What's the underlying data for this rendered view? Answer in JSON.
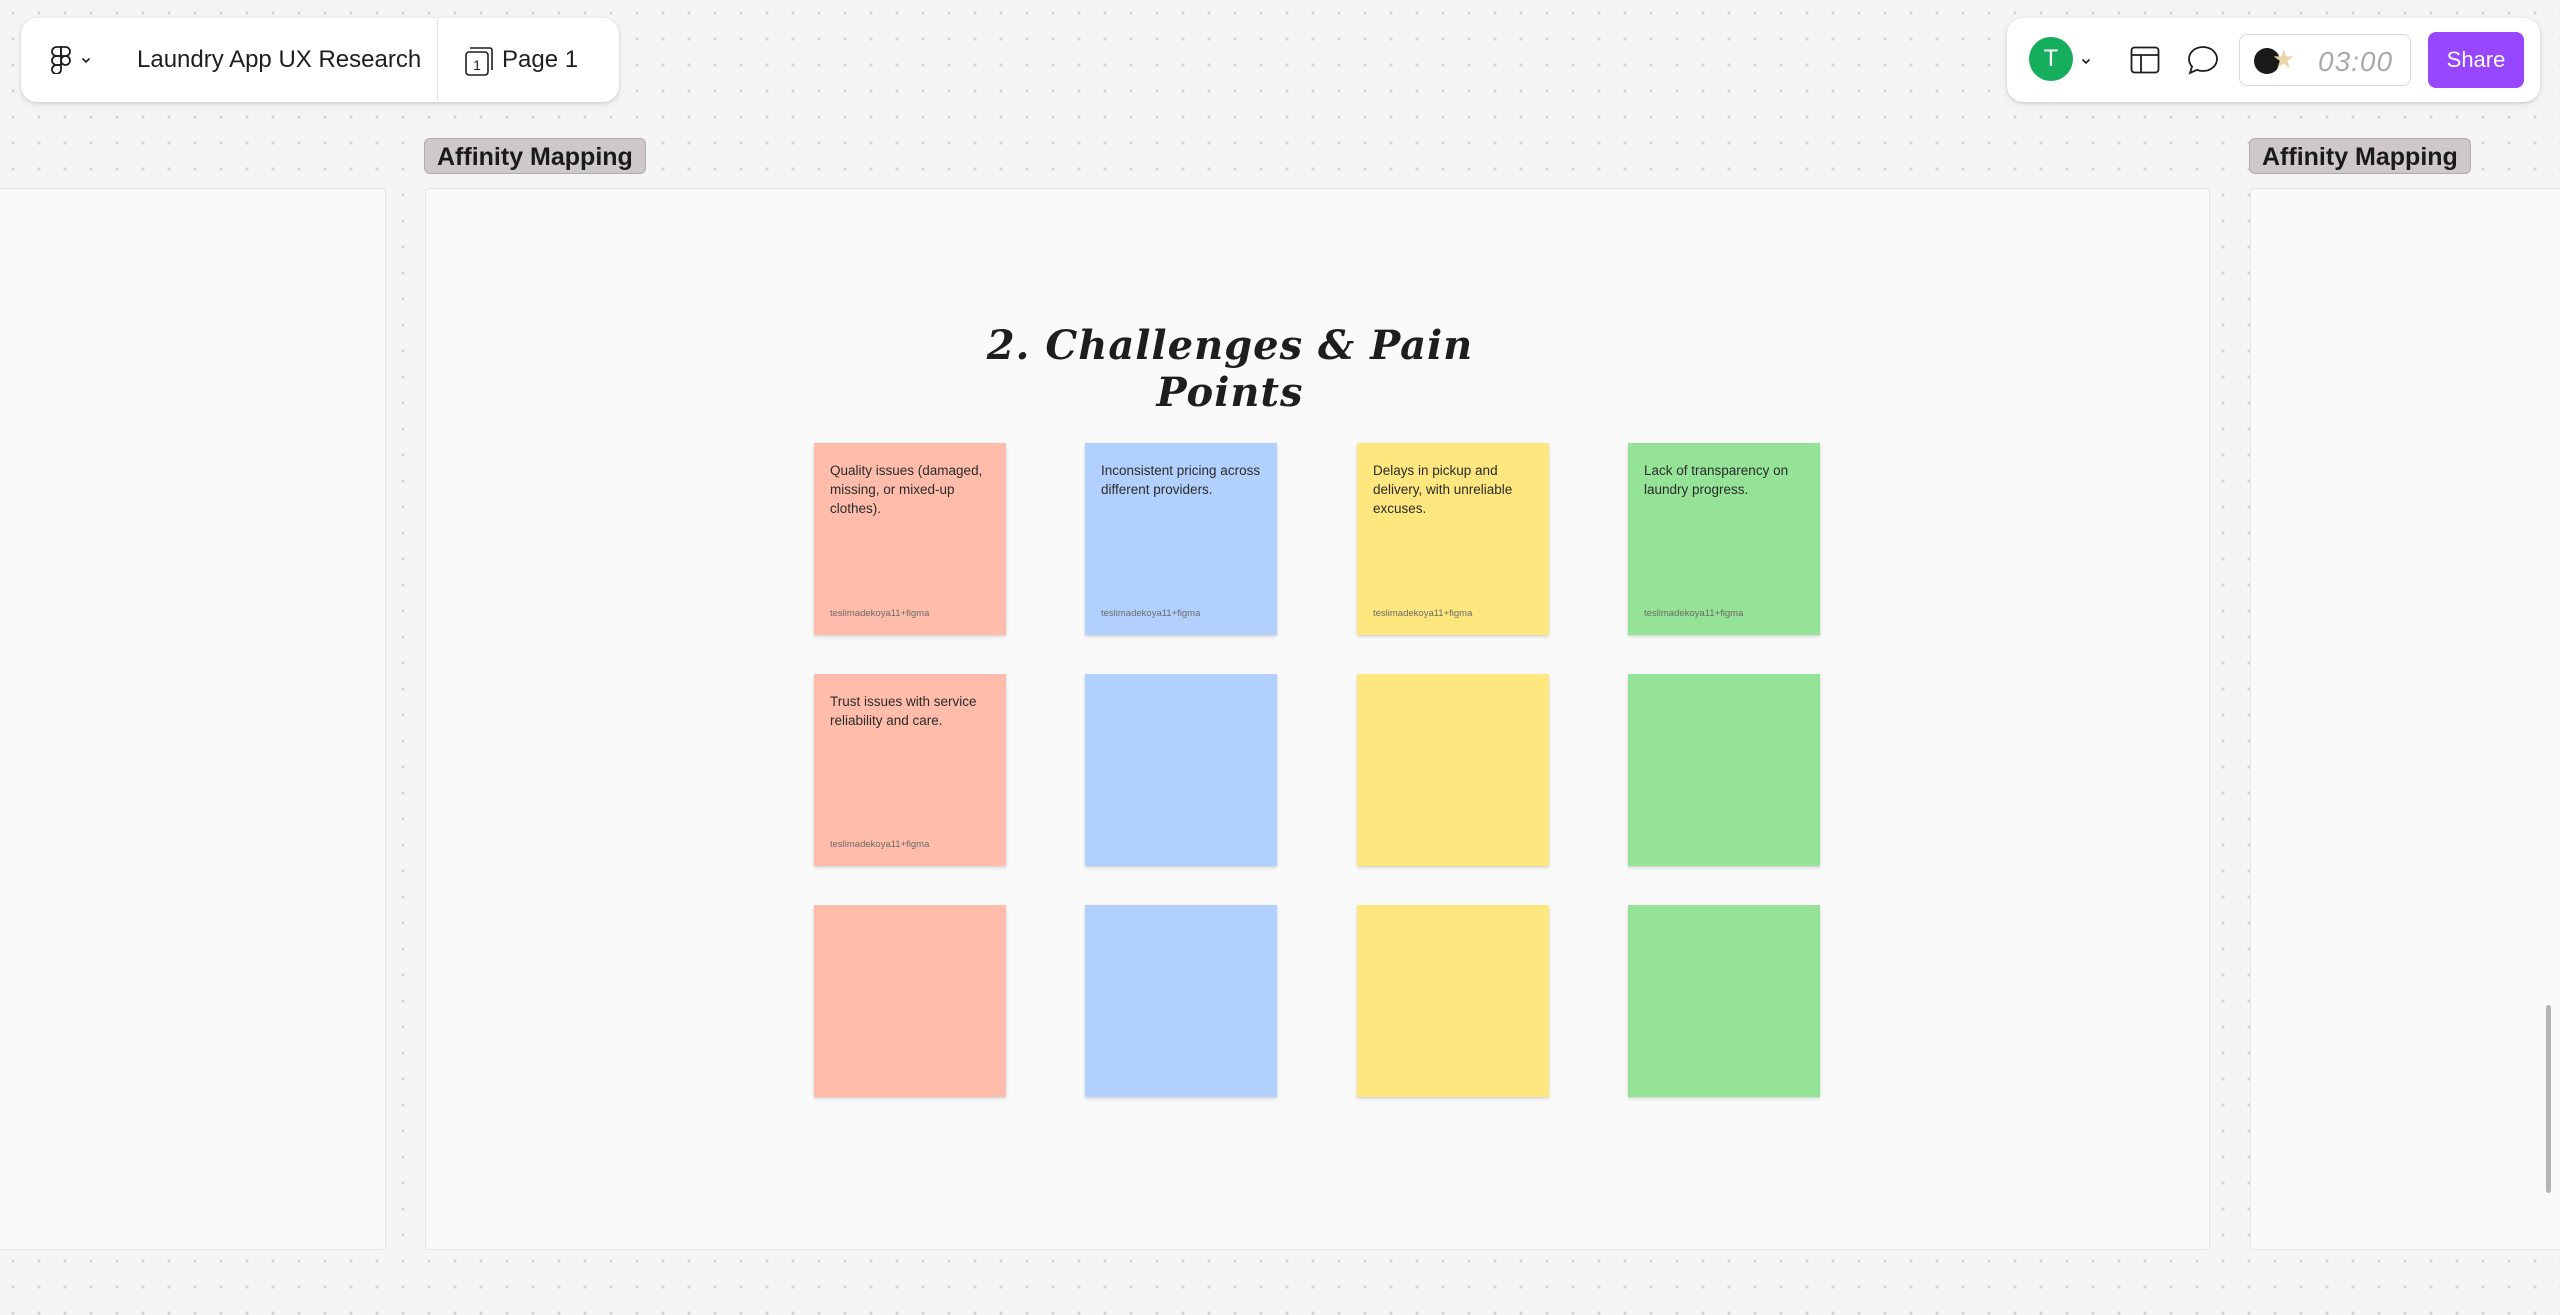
{
  "toolbar": {
    "file_title": "Laundry App UX Research",
    "page_number": "1",
    "page_label": "Page 1"
  },
  "toolbar_right": {
    "avatar_initial": "T",
    "timer": "03:00",
    "share_label": "Share",
    "share_color": "#9747ff",
    "avatar_color": "#14ae5c"
  },
  "frames": {
    "center_label": "Affinity Mapping",
    "right_label": "Affinity Mapping"
  },
  "board": {
    "heading": "2. Challenges & Pain Points",
    "stickies": [
      {
        "color": "#ffbcaa",
        "text": "Quality issues (damaged, missing, or mixed-up clothes).",
        "author": "teslimadekoya11+figma"
      },
      {
        "color": "#b2d0fd",
        "text": "Inconsistent pricing across different providers.",
        "author": "teslimadekoya11+figma"
      },
      {
        "color": "#fee77e",
        "text": "Delays in pickup and delivery, with unreliable excuses.",
        "author": "teslimadekoya11+figma"
      },
      {
        "color": "#94e396",
        "text": "Lack of transparency on laundry progress.",
        "author": "teslimadekoya11+figma"
      },
      {
        "color": "#ffbcaa",
        "text": "Trust issues with service reliability and care.",
        "author": "teslimadekoya11+figma"
      }
    ]
  }
}
